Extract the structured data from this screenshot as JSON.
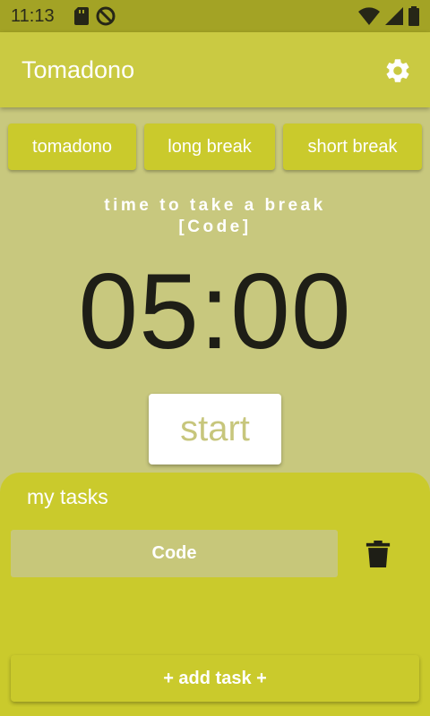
{
  "status_bar": {
    "time": "11:13"
  },
  "app_bar": {
    "title": "Tomadono",
    "settings_icon": "gear-icon"
  },
  "modes": [
    {
      "label": "tomadono"
    },
    {
      "label": "long break"
    },
    {
      "label": "short break"
    }
  ],
  "session": {
    "message": "time to take a break",
    "task_tag": "[Code]",
    "timer": "05:00",
    "start_label": "start"
  },
  "tasks": {
    "title": "my tasks",
    "items": [
      {
        "label": "Code",
        "delete_icon": "trash-icon"
      }
    ],
    "add_label": "+ add task +"
  },
  "colors": {
    "accent": "#caca2c",
    "background": "#c8c87e",
    "status_bar": "#a3a325",
    "timer_text": "#1e1e16"
  }
}
